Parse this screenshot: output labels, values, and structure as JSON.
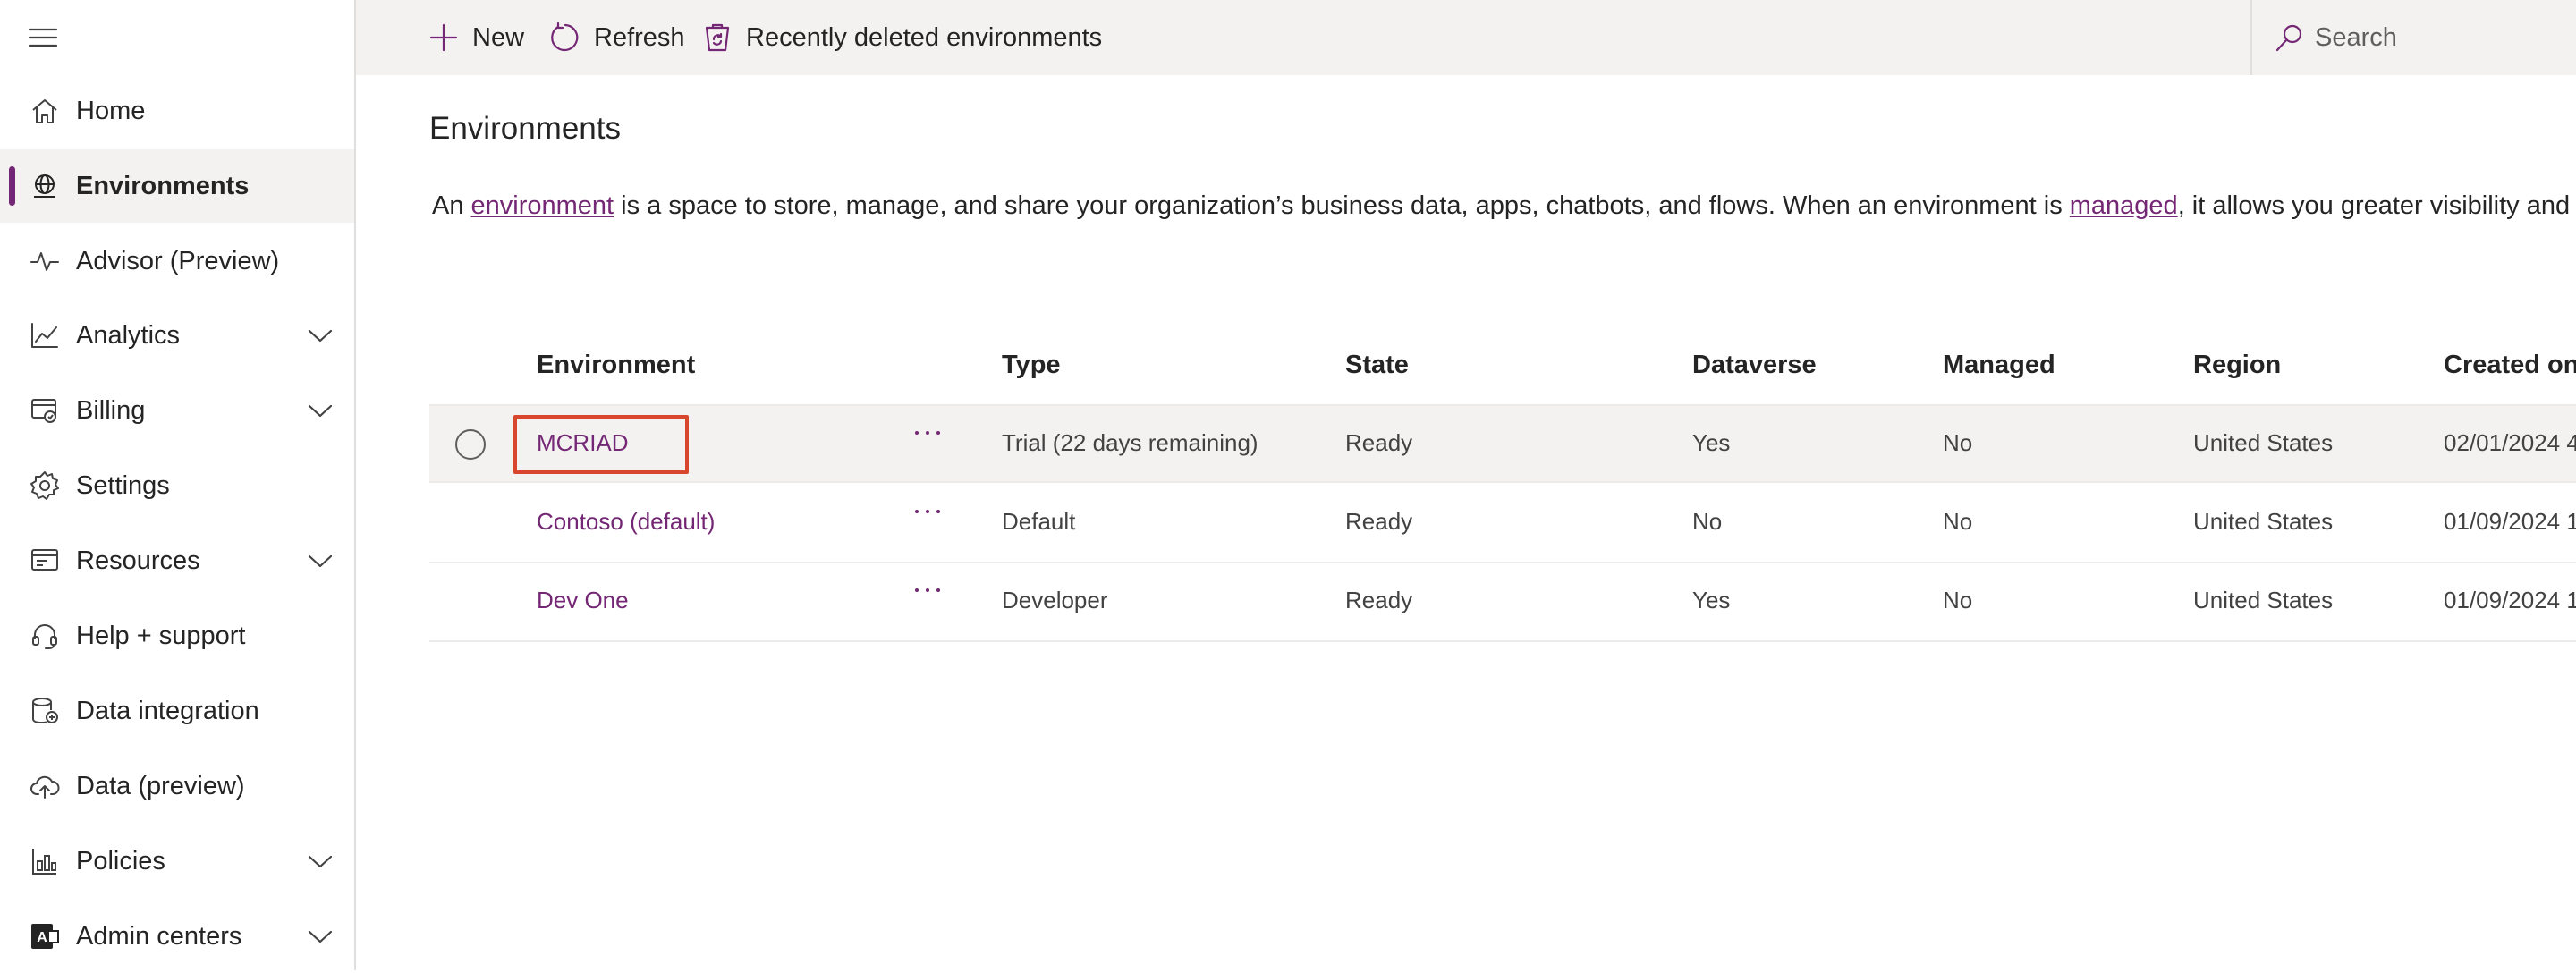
{
  "sidebar": {
    "items": [
      {
        "label": "Home",
        "icon": "home-icon",
        "expandable": false,
        "active": false
      },
      {
        "label": "Environments",
        "icon": "globe-icon",
        "expandable": false,
        "active": true
      },
      {
        "label": "Advisor (Preview)",
        "icon": "pulse-icon",
        "expandable": false,
        "active": false
      },
      {
        "label": "Analytics",
        "icon": "chart-line-icon",
        "expandable": true,
        "active": false
      },
      {
        "label": "Billing",
        "icon": "billing-icon",
        "expandable": true,
        "active": false
      },
      {
        "label": "Settings",
        "icon": "gear-icon",
        "expandable": false,
        "active": false
      },
      {
        "label": "Resources",
        "icon": "resources-icon",
        "expandable": true,
        "active": false
      },
      {
        "label": "Help + support",
        "icon": "headset-icon",
        "expandable": false,
        "active": false
      },
      {
        "label": "Data integration",
        "icon": "database-icon",
        "expandable": false,
        "active": false
      },
      {
        "label": "Data (preview)",
        "icon": "cloud-upload-icon",
        "expandable": false,
        "active": false
      },
      {
        "label": "Policies",
        "icon": "policies-icon",
        "expandable": true,
        "active": false
      },
      {
        "label": "Admin centers",
        "icon": "admin-centers-icon",
        "expandable": true,
        "active": false
      }
    ]
  },
  "toolbar": {
    "new_label": "New",
    "refresh_label": "Refresh",
    "recently_deleted_label": "Recently deleted environments",
    "search_placeholder": "Search"
  },
  "page": {
    "title": "Environments",
    "description": {
      "prefix": "An ",
      "link1": "environment",
      "middle": " is a space to store, manage, and share your organization’s business data, apps, chatbots, and flows. When an environment is ",
      "link2": "managed",
      "suffix": ", it allows you greater visibility and control."
    }
  },
  "table": {
    "columns": [
      "Environment",
      "Type",
      "State",
      "Dataverse",
      "Managed",
      "Region",
      "Created on"
    ],
    "rows": [
      {
        "name": "MCRIAD",
        "type": "Trial (22 days remaining)",
        "state": "Ready",
        "dataverse": "Yes",
        "managed": "No",
        "region": "United States",
        "created": "02/01/2024 4",
        "selected": true,
        "highlighted": true
      },
      {
        "name": "Contoso (default)",
        "type": "Default",
        "state": "Ready",
        "dataverse": "No",
        "managed": "No",
        "region": "United States",
        "created": "01/09/2024 1",
        "selected": false,
        "highlighted": false
      },
      {
        "name": "Dev One",
        "type": "Developer",
        "state": "Ready",
        "dataverse": "Yes",
        "managed": "No",
        "region": "United States",
        "created": "01/09/2024 1",
        "selected": false,
        "highlighted": false
      }
    ]
  },
  "colors": {
    "accent": "#742774",
    "highlight": "#d9462e",
    "command_bar_bg": "#f3f2f1"
  }
}
